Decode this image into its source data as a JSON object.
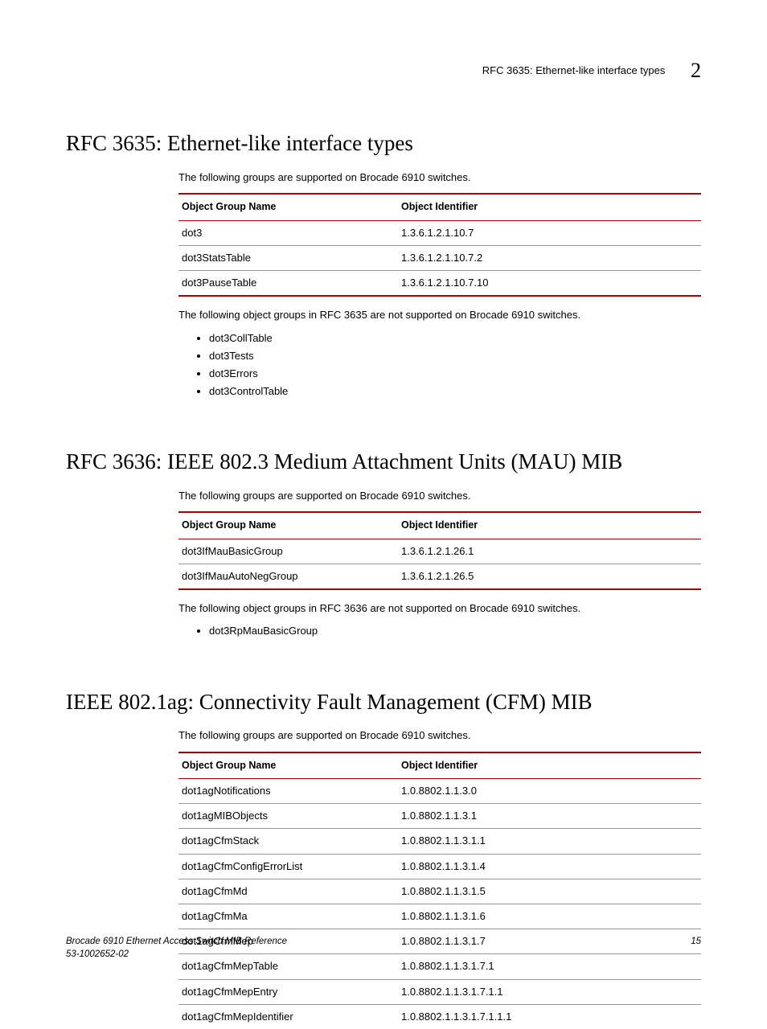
{
  "header": {
    "title": "RFC 3635: Ethernet-like interface types",
    "chapter": "2"
  },
  "sections": [
    {
      "heading": "RFC 3635: Ethernet-like interface types",
      "intro": "The following groups are supported on Brocade 6910 switches.",
      "th_name": "Object Group Name",
      "th_id": "Object Identifier",
      "rows": [
        {
          "name": "dot3",
          "id": "1.3.6.1.2.1.10.7"
        },
        {
          "name": "dot3StatsTable",
          "id": "1.3.6.1.2.1.10.7.2"
        },
        {
          "name": "dot3PauseTable",
          "id": "1.3.6.1.2.1.10.7.10"
        }
      ],
      "after_para": "The following object groups in RFC 3635 are not supported on Brocade 6910 switches.",
      "bullets": [
        "dot3CollTable",
        "dot3Tests",
        "dot3Errors",
        "dot3ControlTable"
      ]
    },
    {
      "heading": "RFC 3636: IEEE 802.3 Medium Attachment Units (MAU) MIB",
      "intro": "The following groups are supported on Brocade 6910 switches.",
      "th_name": "Object Group Name",
      "th_id": "Object Identifier",
      "rows": [
        {
          "name": "dot3IfMauBasicGroup",
          "id": "1.3.6.1.2.1.26.1"
        },
        {
          "name": "dot3IfMauAutoNegGroup",
          "id": "1.3.6.1.2.1.26.5"
        }
      ],
      "after_para": "The following object groups in RFC 3636 are not supported on Brocade 6910 switches.",
      "bullets": [
        "dot3RpMauBasicGroup"
      ]
    },
    {
      "heading": "IEEE 802.1ag: Connectivity Fault Management (CFM) MIB",
      "intro": "The following groups are supported on Brocade 6910 switches.",
      "th_name": "Object Group Name",
      "th_id": "Object Identifier",
      "rows": [
        {
          "name": "dot1agNotifications",
          "id": "1.0.8802.1.1.3.0"
        },
        {
          "name": "dot1agMIBObjects",
          "id": "1.0.8802.1.1.3.1"
        },
        {
          "name": "dot1agCfmStack",
          "id": "1.0.8802.1.1.3.1.1"
        },
        {
          "name": "dot1agCfmConfigErrorList",
          "id": "1.0.8802.1.1.3.1.4"
        },
        {
          "name": "dot1agCfmMd",
          "id": "1.0.8802.1.1.3.1.5"
        },
        {
          "name": "dot1agCfmMa",
          "id": "1.0.8802.1.1.3.1.6"
        },
        {
          "name": "dot1agCfmMep",
          "id": "1.0.8802.1.1.3.1.7"
        },
        {
          "name": "dot1agCfmMepTable",
          "id": "1.0.8802.1.1.3.1.7.1"
        },
        {
          "name": "dot1agCfmMepEntry",
          "id": "1.0.8802.1.1.3.1.7.1.1"
        },
        {
          "name": "dot1agCfmMepIdentifier",
          "id": "1.0.8802.1.1.3.1.7.1.1.1"
        }
      ],
      "after_para": "",
      "bullets": [],
      "last_row_open": true
    }
  ],
  "footer": {
    "line1": "Brocade 6910 Ethernet Access Switch MIB Reference",
    "line2": "53-1002652-02",
    "page": "15"
  }
}
